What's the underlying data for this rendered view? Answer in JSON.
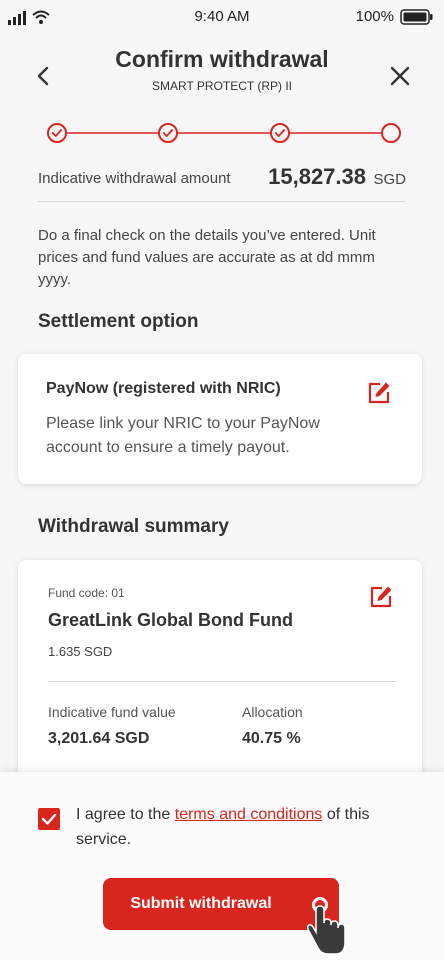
{
  "status_bar": {
    "time": "9:40 AM",
    "battery": "100%"
  },
  "header": {
    "title": "Confirm withdrawal",
    "subtitle": "SMART PROTECT (RP) II"
  },
  "stepper": {
    "total_steps": 4,
    "completed_steps": 3,
    "accent": "#d8261f"
  },
  "amount": {
    "label": "Indicative withdrawal amount",
    "value": "15,827.38",
    "currency": "SGD"
  },
  "info_text": "Do a final check on the details you’ve entered. Unit prices and fund values are accurate as at dd mmm yyyy.",
  "settlement": {
    "section_title": "Settlement option",
    "option_title": "PayNow (registered with NRIC)",
    "option_desc": "Please link your NRIC to your PayNow account to ensure a timely payout."
  },
  "summary": {
    "section_title": "Withdrawal summary",
    "fund_code": "Fund code: 01",
    "fund_name": "GreatLink Global Bond Fund",
    "unit_price": "1.635 SGD",
    "fund_value_label": "Indicative fund value",
    "fund_value": "3,201.64 SGD",
    "allocation_label": "Allocation",
    "allocation_value": "40.75 %"
  },
  "consent": {
    "prefix": "I agree to the",
    "link_text": "terms and conditions",
    "suffix": "of this service.",
    "checked": true
  },
  "submit_label": "Submit withdrawal",
  "icons": [
    "signal-icon",
    "wifi-icon",
    "battery-icon",
    "back-chevron-icon",
    "close-icon",
    "edit-icon",
    "check-icon",
    "hand-pointer-icon"
  ],
  "colors": {
    "accent": "#d8261f",
    "background": "#f7f7f7",
    "card": "#ffffff"
  }
}
